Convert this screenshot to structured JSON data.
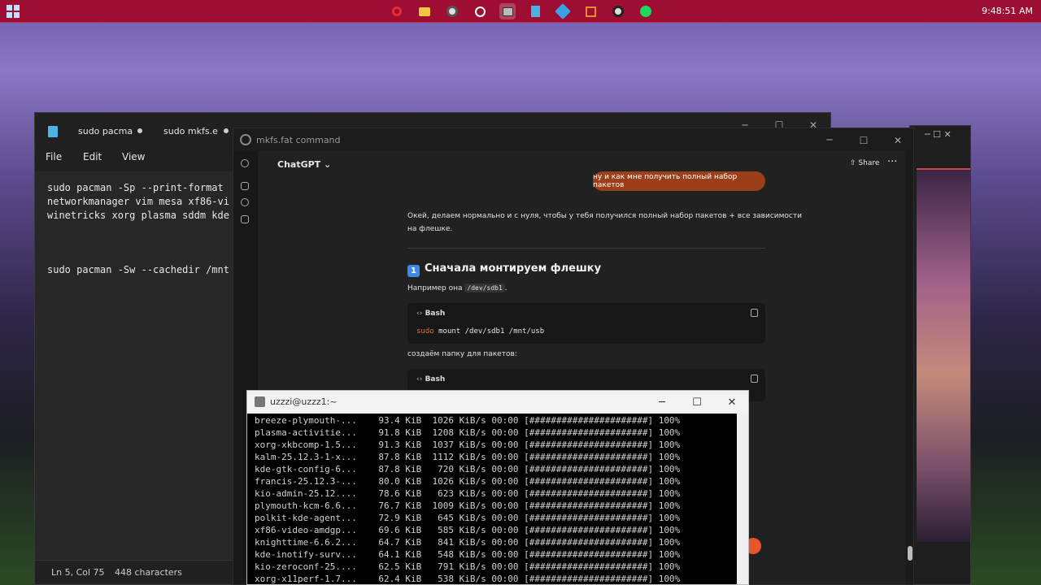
{
  "taskbar": {
    "apps": [
      "opera-icon",
      "file-explorer-icon",
      "obs-icon",
      "chatgpt-icon",
      "putty-icon",
      "notepad-icon",
      "vs-icon",
      "vmware-icon",
      "github-icon",
      "spotify-icon"
    ],
    "clock": "9:48:51 AM"
  },
  "notepad": {
    "tabs": [
      "sudo pacma",
      "sudo mkfs.e"
    ],
    "menu": [
      "File",
      "Edit",
      "View"
    ],
    "lines": [
      "sudo pacman -Sp --print-format",
      "networkmanager vim mesa xf86-vi",
      "winetricks xorg plasma sddm kde",
      "",
      "",
      "sudo pacman -Sw --cachedir /mnt"
    ],
    "status": {
      "pos": "Ln 5, Col 75",
      "chars": "448 characters"
    }
  },
  "chatgpt": {
    "window_title": "mkfs.fat command",
    "model": "ChatGPT",
    "share": "Share",
    "user_msg": "ну и как мне получить полный набор пакетов",
    "answer_intro_1": "Окей, делаем нормально и с нуля, чтобы у тебя получился полный набор пакетов + все зависимости",
    "answer_intro_2": "на флешке.",
    "step_num": "1",
    "step_title": "Сначала монтируем флешку",
    "example_prefix": "Например она",
    "example_dev": "/dev/sdb1",
    "example_suffix": ".",
    "code_lang": "Bash",
    "code1_kw": "sudo",
    "code1_rest": " mount /dev/sdb1 /mnt/usb",
    "create_dir": "создаём папку для пакетов:",
    "code2_lang": "Bash"
  },
  "terminal": {
    "title": "uzzzi@uzzz1:~",
    "rows": [
      "breeze-plymouth-...    93.4 KiB  1026 KiB/s 00:00 [######################] 100%",
      "plasma-activitie...    91.8 KiB  1208 KiB/s 00:00 [######################] 100%",
      "xorg-xkbcomp-1.5...    91.3 KiB  1037 KiB/s 00:00 [######################] 100%",
      "kalm-25.12.3-1-x...    87.8 KiB  1112 KiB/s 00:00 [######################] 100%",
      "kde-gtk-config-6...    87.8 KiB   720 KiB/s 00:00 [######################] 100%",
      "francis-25.12.3-...    80.0 KiB  1026 KiB/s 00:00 [######################] 100%",
      "kio-admin-25.12....    78.6 KiB   623 KiB/s 00:00 [######################] 100%",
      "plymouth-kcm-6.6...    76.7 KiB  1009 KiB/s 00:00 [######################] 100%",
      "polkit-kde-agent...    72.9 KiB   645 KiB/s 00:00 [######################] 100%",
      "xf86-video-amdgp...    69.6 KiB   585 KiB/s 00:00 [######################] 100%",
      "knighttime-6.6.2...    64.7 KiB   841 KiB/s 00:00 [######################] 100%",
      "kde-inotify-surv...    64.1 KiB   548 KiB/s 00:00 [######################] 100%",
      "kio-zeroconf-25....    62.5 KiB   791 KiB/s 00:00 [######################] 100%",
      "xorg-x11perf-1.7...    62.4 KiB   538 KiB/s 00:00 [######################] 100%"
    ]
  }
}
